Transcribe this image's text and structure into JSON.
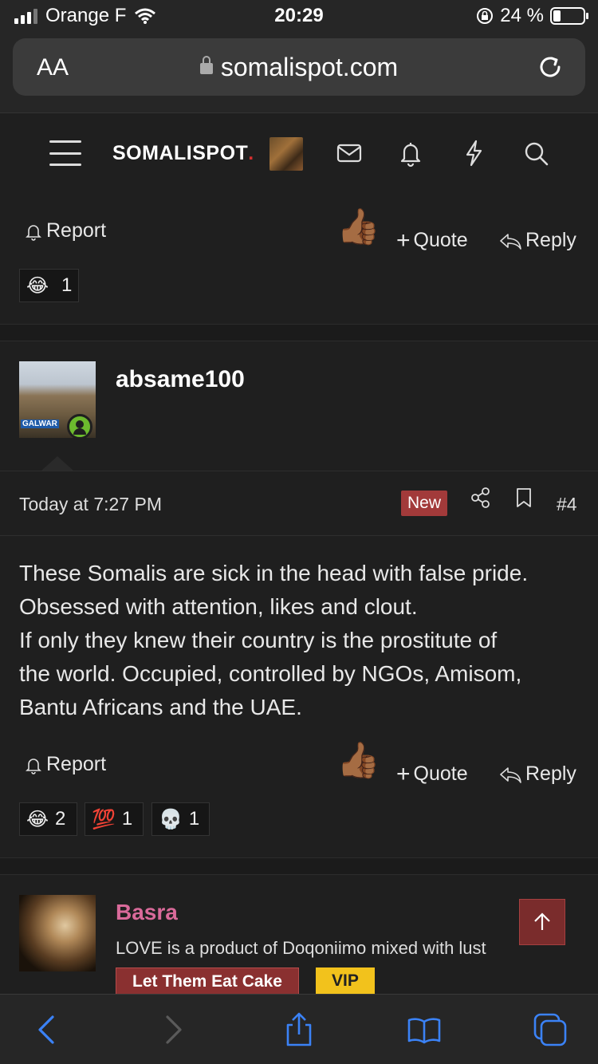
{
  "status": {
    "carrier": "Orange F",
    "time": "20:29",
    "battery": "24 %"
  },
  "browser": {
    "aa_label": "AA",
    "url": "somalispot.com"
  },
  "header": {
    "logo": "SOMALISPOT"
  },
  "post1": {
    "report": "Report",
    "quote": "Quote",
    "reply": "Reply",
    "reactions": [
      {
        "icon": "😂",
        "count": "1"
      }
    ]
  },
  "post2": {
    "username": "absame100",
    "avatar_tag": "GALWAR",
    "date": "Today at 7:27 PM",
    "new_badge": "New",
    "post_number": "#4",
    "body": [
      "These Somalis are sick in the head with false pride.",
      "Obsessed with attention, likes and clout.",
      "If only they knew their country is the prostitute of",
      "the world. Occupied, controlled by NGOs, Amisom,",
      "Bantu Africans and the UAE."
    ],
    "report": "Report",
    "quote": "Quote",
    "reply": "Reply",
    "reactions": [
      {
        "icon": "😂",
        "count": "2"
      },
      {
        "icon": "💯",
        "count": "1"
      },
      {
        "icon": "💀",
        "count": "1"
      }
    ]
  },
  "post3": {
    "username": "Basra",
    "tagline": "LOVE is a product of Doqoniimo mixed with lust",
    "banner": "Let Them Eat Cake",
    "vip": "VIP"
  },
  "colors": {
    "new_badge": "#a23a3a",
    "vip": "#f2c21c",
    "username_pink": "#d96a9a",
    "link_blue": "#3b82f6"
  }
}
